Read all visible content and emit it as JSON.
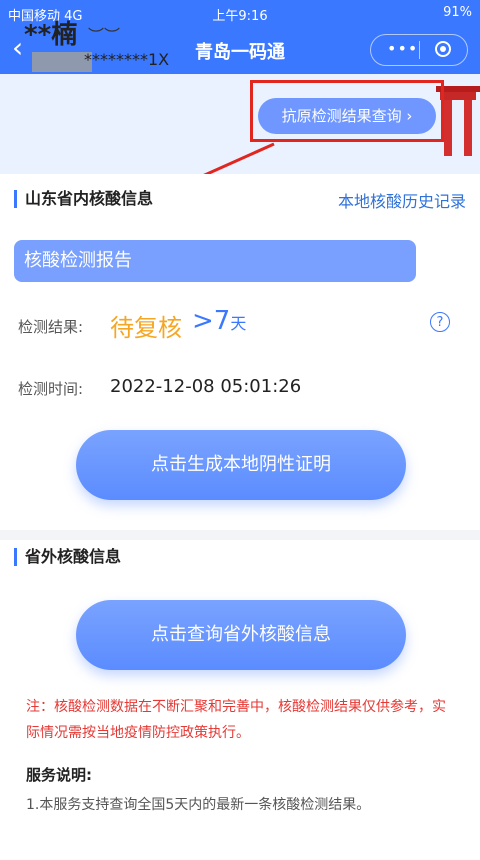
{
  "status_bar": {
    "carrier": "中国移动 4G",
    "time": "上午9:16",
    "indicators": "91%"
  },
  "nav": {
    "back_icon": "‹",
    "title": "青岛一码通",
    "more_icon": "•••"
  },
  "user": {
    "name": "**楠",
    "id_suffix": "********1X"
  },
  "antigen_button": "抗原检测结果查询 ›",
  "section1": {
    "title": "山东省内核酸信息",
    "history_link": "本地核酸历史记录"
  },
  "report_label": "核酸检测报告",
  "result": {
    "label": "检测结果:",
    "status": "待复核",
    "days_main": ">7",
    "days_unit": "天",
    "help_icon": "?"
  },
  "test_time": {
    "label": "检测时间:",
    "value": "2022-12-08 05:01:26"
  },
  "btn_generate": "点击生成本地阴性证明",
  "section2": {
    "title": "省外核酸信息"
  },
  "btn_query": "点击查询省外核酸信息",
  "notice": "注：核酸检测数据在不断汇聚和完善中，核酸检测结果仅供参考，实际情况需按当地疫情防控政策执行。",
  "service": {
    "title": "服务说明:",
    "item1": "1.本服务支持查询全国5天内的最新一条核酸检测结果。"
  },
  "colors": {
    "primary": "#3a78ff",
    "warning": "#f5a623",
    "alert": "#e53935"
  }
}
